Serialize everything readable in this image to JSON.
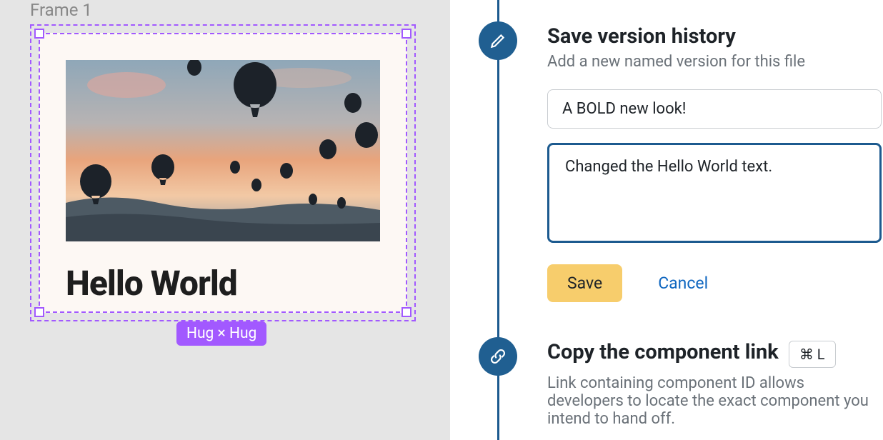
{
  "canvas": {
    "frame_label": "Frame 1",
    "hello_text": "Hello World",
    "size_badge": "Hug × Hug"
  },
  "version": {
    "title": "Save version history",
    "subtitle": "Add a new named version for this file",
    "name_value": "A BOLD new look!",
    "description_value": "Changed the Hello World text.",
    "save_label": "Save",
    "cancel_label": "Cancel"
  },
  "copy": {
    "title": "Copy the component link",
    "kbd": "⌘ L",
    "subtitle": "Link containing component ID allows developers to locate the exact component you intend to hand off."
  }
}
